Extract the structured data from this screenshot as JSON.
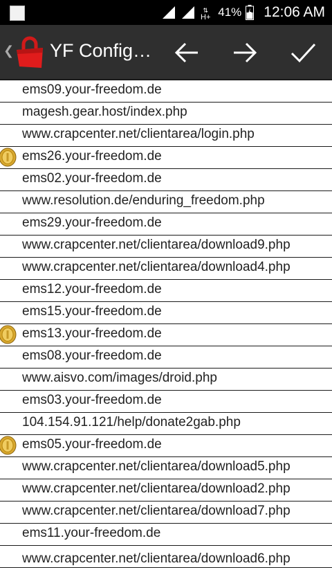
{
  "status_bar": {
    "network_type": "H+",
    "battery_percent": "41%",
    "time": "12:06 AM"
  },
  "action_bar": {
    "title": "YF Config…",
    "icons": [
      "back-arrow-icon",
      "forward-arrow-icon",
      "checkmark-icon"
    ]
  },
  "list": {
    "items": [
      {
        "text": "ems09.your-freedom.de",
        "coin": false
      },
      {
        "text": "magesh.gear.host/index.php",
        "coin": false
      },
      {
        "text": "www.crapcenter.net/clientarea/login.php",
        "coin": false
      },
      {
        "text": "ems26.your-freedom.de",
        "coin": true
      },
      {
        "text": "ems02.your-freedom.de",
        "coin": false
      },
      {
        "text": "www.resolution.de/enduring_freedom.php",
        "coin": false
      },
      {
        "text": "ems29.your-freedom.de",
        "coin": false
      },
      {
        "text": "www.crapcenter.net/clientarea/download9.php",
        "coin": false
      },
      {
        "text": "www.crapcenter.net/clientarea/download4.php",
        "coin": false
      },
      {
        "text": "ems12.your-freedom.de",
        "coin": false
      },
      {
        "text": "ems15.your-freedom.de",
        "coin": false
      },
      {
        "text": "ems13.your-freedom.de",
        "coin": true
      },
      {
        "text": "ems08.your-freedom.de",
        "coin": false
      },
      {
        "text": "www.aisvo.com/images/droid.php",
        "coin": false
      },
      {
        "text": "ems03.your-freedom.de",
        "coin": false
      },
      {
        "text": "104.154.91.121/help/donate2gab.php",
        "coin": false
      },
      {
        "text": "ems05.your-freedom.de",
        "coin": true
      },
      {
        "text": "www.crapcenter.net/clientarea/download5.php",
        "coin": false
      },
      {
        "text": "www.crapcenter.net/clientarea/download2.php",
        "coin": false
      },
      {
        "text": "www.crapcenter.net/clientarea/download7.php",
        "coin": false
      },
      {
        "text": "ems11.your-freedom.de",
        "coin": false
      },
      {
        "text": "www.crapcenter.net/clientarea/download6.php",
        "coin": false
      }
    ]
  }
}
